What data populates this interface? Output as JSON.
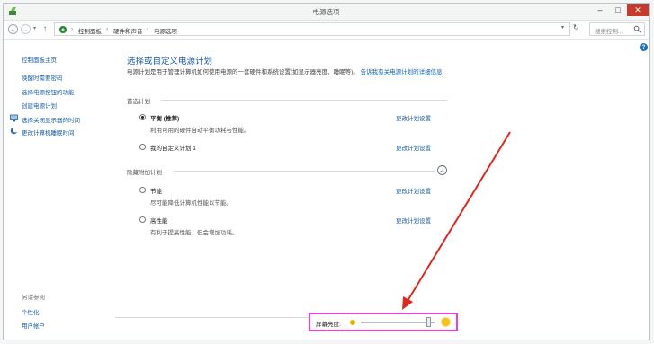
{
  "window": {
    "title": "电源选项",
    "controls": {
      "minimize": "–",
      "maximize": "□",
      "close": "✕"
    }
  },
  "addressbar": {
    "breadcrumbs": [
      "控制面板",
      "硬件和声音",
      "电源选项"
    ],
    "separator": "›",
    "search_placeholder": "搜索控制...",
    "icons": {
      "back": "back-arrow-icon",
      "forward": "forward-arrow-icon",
      "up": "up-arrow-icon",
      "refresh": "refresh-icon",
      "search": "search-icon"
    }
  },
  "sidebar": {
    "items": [
      {
        "label": "控制面板主页",
        "icon": ""
      },
      {
        "label": "唤醒时需要密码",
        "icon": ""
      },
      {
        "label": "选择电源按钮的功能",
        "icon": ""
      },
      {
        "label": "创建电源计划",
        "icon": ""
      },
      {
        "label": "选择关闭显示器的时间",
        "icon": "monitor-icon"
      },
      {
        "label": "更改计算机睡眠时间",
        "icon": "moon-icon"
      }
    ],
    "see_also": "另请参阅",
    "bottom_items": [
      {
        "label": "个性化"
      },
      {
        "label": "用户帐户"
      }
    ]
  },
  "main": {
    "title": "选择或自定义电源计划",
    "description": "电源计划是用于管理计算机如何使用电源的一套硬件和系统设置(如显示器亮度、睡眠等)。",
    "description_link": "告诉我有关电源计划的详细信息",
    "groups": [
      {
        "label": "首选计划",
        "plans": [
          {
            "name": "平衡 (推荐)",
            "desc": "利用可用的硬件自动平衡功耗与性能。",
            "link": "更改计划设置",
            "selected": true
          },
          {
            "name": "我的自定义计划 1",
            "desc": "",
            "link": "更改计划设置",
            "selected": false
          }
        ]
      },
      {
        "label": "隐藏附加计划",
        "plans": [
          {
            "name": "节能",
            "desc": "尽可能降低计算机性能以节能。",
            "link": "更改计划设置",
            "selected": false
          },
          {
            "name": "高性能",
            "desc": "有利于提高性能，但会增加功耗。",
            "link": "更改计划设置",
            "selected": false
          }
        ]
      }
    ],
    "expand_icon": "chevron-up-icon"
  },
  "brightness": {
    "label": "屏幕亮度:",
    "value_fraction": 0.92
  },
  "colors": {
    "link": "#1a5fa6",
    "title": "#1d5ba6",
    "close_button": "#c7392a",
    "highlight": "#e843d8",
    "arrow": "#e0281c"
  }
}
